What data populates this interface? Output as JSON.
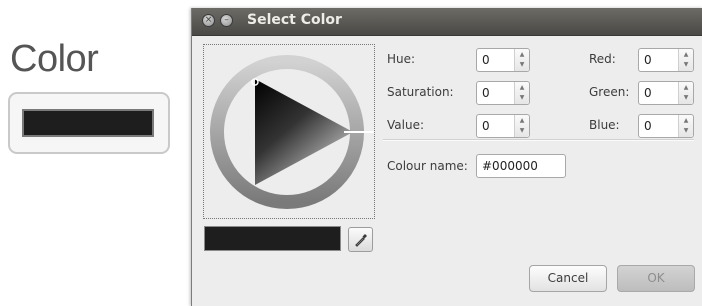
{
  "page": {
    "heading": "Color"
  },
  "color_button": {
    "color": "#1e1e1e"
  },
  "dialog": {
    "title": "Select Color",
    "current_color": "#1e1e1e",
    "fields": {
      "hue": {
        "label": "Hue:",
        "value": "0"
      },
      "saturation": {
        "label": "Saturation:",
        "value": "0"
      },
      "value": {
        "label": "Value:",
        "value": "0"
      },
      "red": {
        "label": "Red:",
        "value": "0"
      },
      "green": {
        "label": "Green:",
        "value": "0"
      },
      "blue": {
        "label": "Blue:",
        "value": "0"
      },
      "colour_name": {
        "label": "Colour name:",
        "value": "#000000"
      }
    },
    "buttons": {
      "cancel": "Cancel",
      "ok": "OK"
    },
    "icons": {
      "close": "close-icon",
      "minimize": "minimize-icon",
      "eyedropper": "eyedropper-icon"
    }
  }
}
